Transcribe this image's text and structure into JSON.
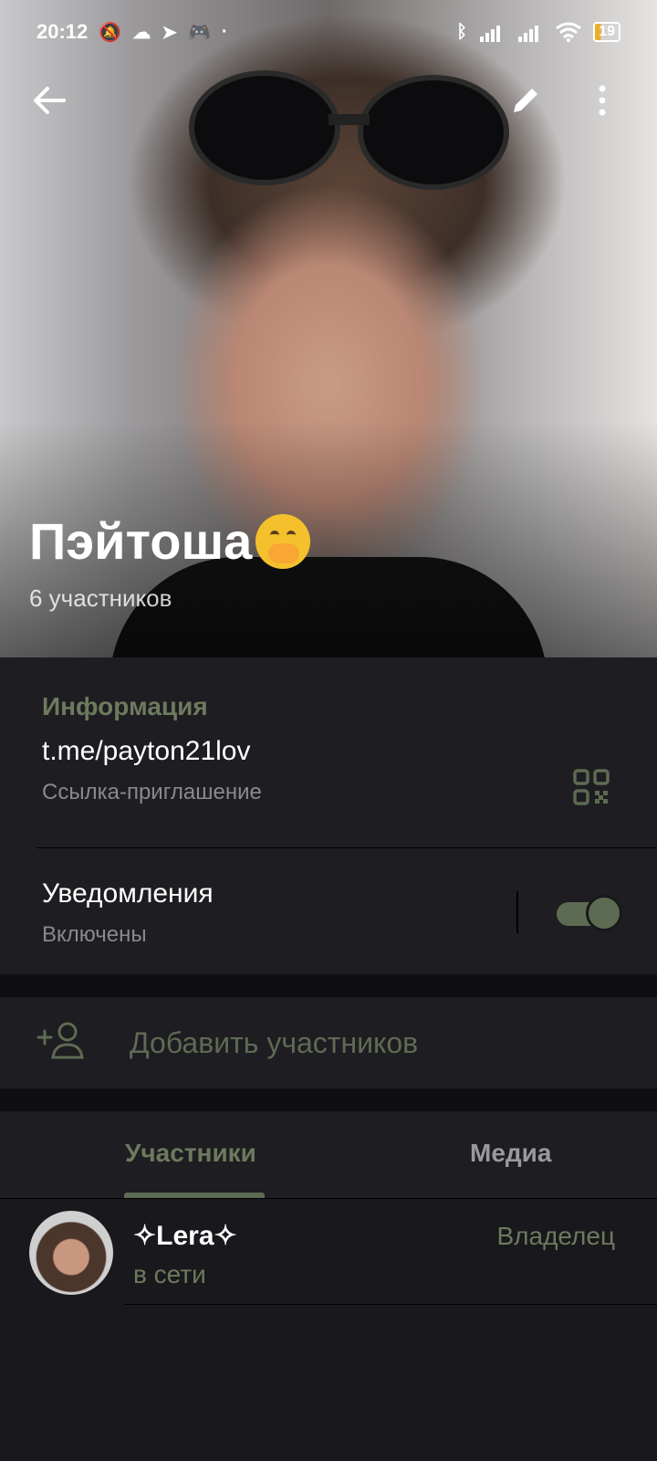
{
  "status_bar": {
    "time": "20:12",
    "battery": "19"
  },
  "header": {
    "title": "Пэйтоша",
    "subtitle": "6 участников"
  },
  "info": {
    "section_title": "Информация",
    "link": "t.me/payton21lov",
    "link_caption": "Ссылка-приглашение",
    "notifications_label": "Уведомления",
    "notifications_state": "Включены",
    "notifications_enabled": true
  },
  "actions": {
    "add_members": "Добавить участников"
  },
  "tabs": [
    {
      "label": "Участники",
      "active": true
    },
    {
      "label": "Медиа",
      "active": false
    }
  ],
  "members": [
    {
      "name": "✧Lera✧",
      "status": "в сети",
      "role": "Владелец"
    }
  ],
  "colors": {
    "accent": "#5d6b52",
    "accent_text": "#6d7a5e",
    "background": "#19181c",
    "surface": "#1e1d21"
  }
}
